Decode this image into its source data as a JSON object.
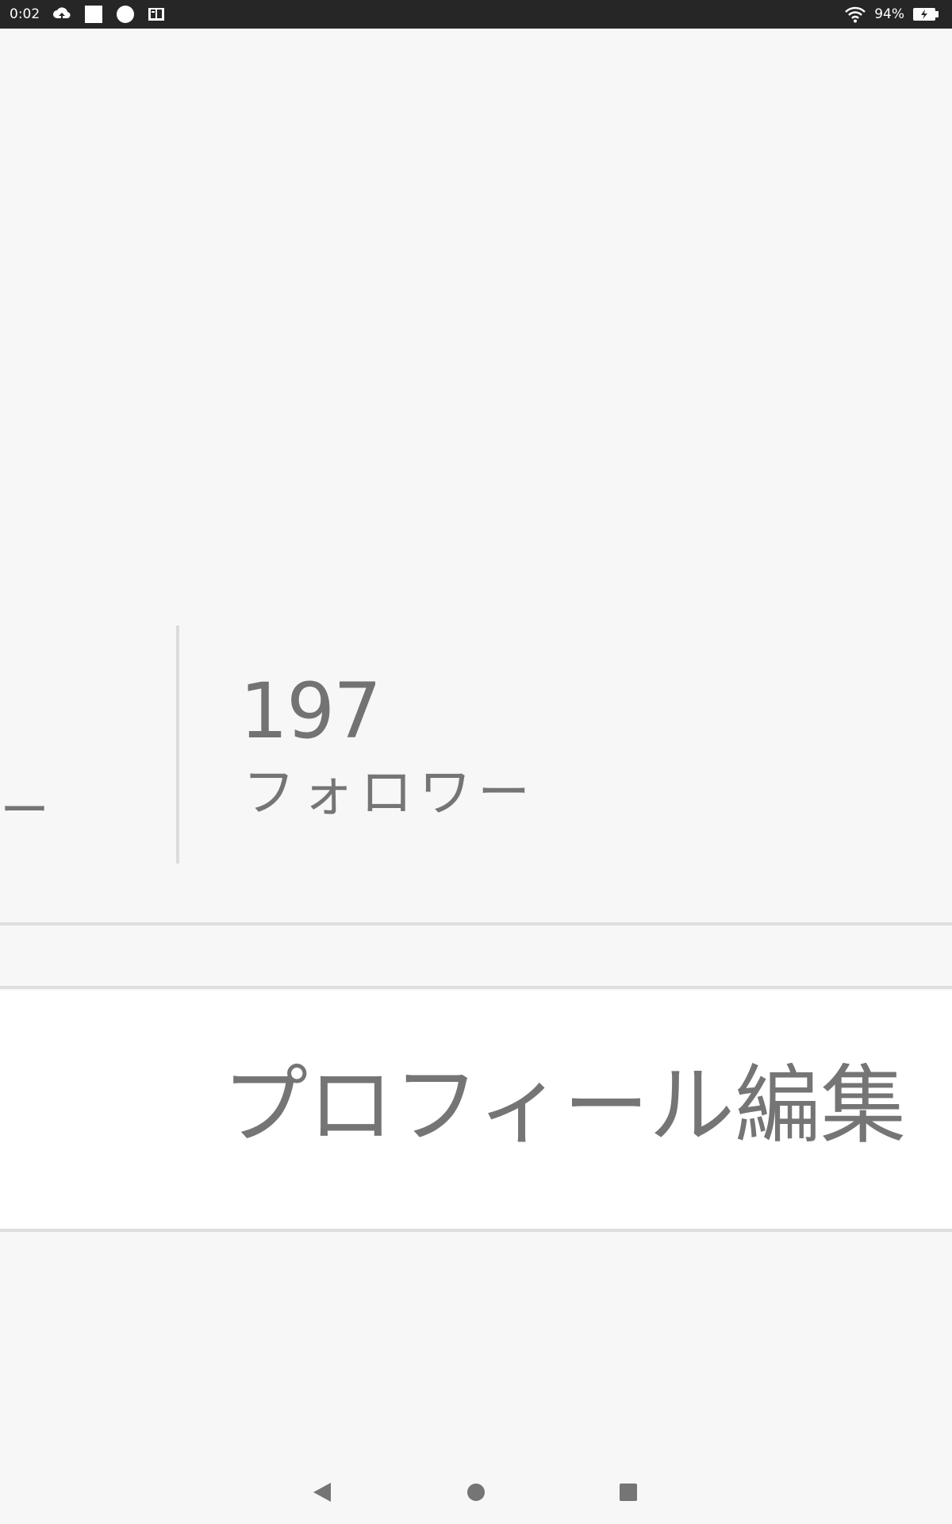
{
  "status_bar": {
    "time": "0:02",
    "battery_percent": "94%",
    "icons": [
      "cloud-upload-icon",
      "square-icon",
      "circle-icon",
      "book-icon",
      "wifi-icon",
      "battery-charging-icon"
    ]
  },
  "stats": {
    "previous_label_fragment": "ー",
    "followers": {
      "count": "197",
      "label": "フォロワー"
    }
  },
  "edit_profile": {
    "label": "プロフィール編集"
  },
  "nav_bar": {
    "icons": [
      "back-triangle-icon",
      "home-circle-icon",
      "recents-square-icon"
    ]
  },
  "colors": {
    "background": "#f7f7f7",
    "status_bar": "#262626",
    "text_gray": "#757575",
    "divider": "#dedede",
    "panel": "#ffffff"
  }
}
